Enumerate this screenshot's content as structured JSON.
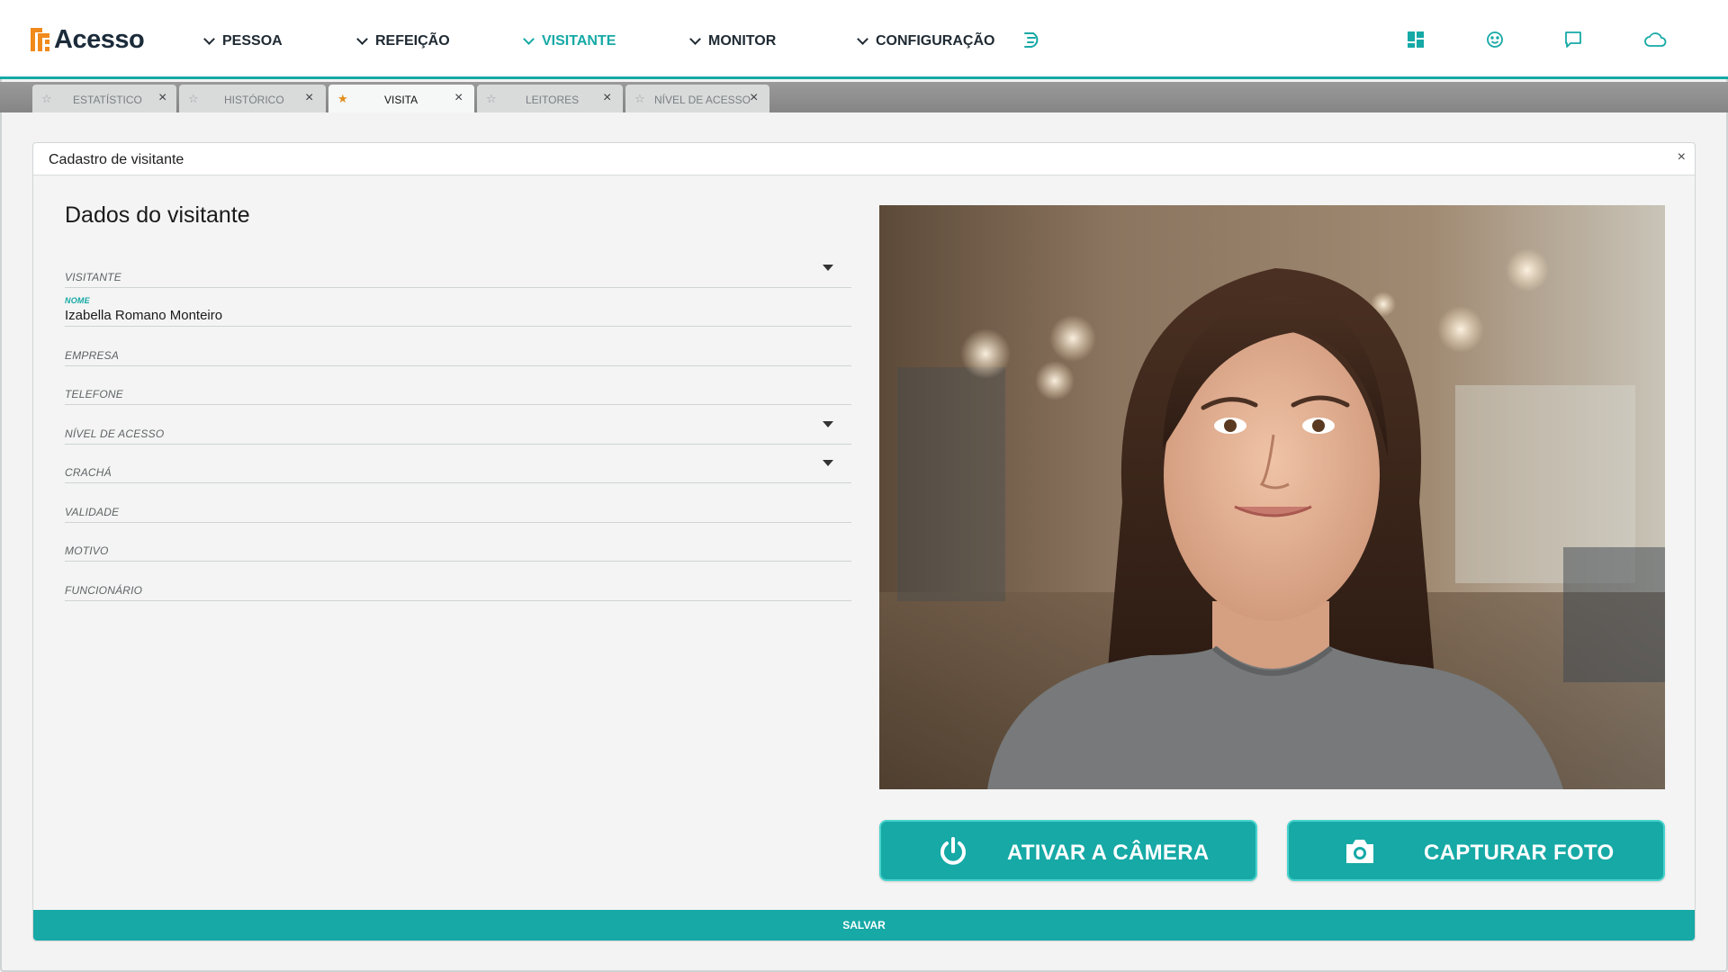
{
  "app": {
    "logo_text": "Acesso",
    "brand_color": "#16a9a6",
    "logo_color": "#f08a1c"
  },
  "nav": {
    "items": [
      {
        "label": "PESSOA",
        "active": false
      },
      {
        "label": "REFEIÇÃO",
        "active": false
      },
      {
        "label": "VISITANTE",
        "active": true
      },
      {
        "label": "MONITOR",
        "active": false
      },
      {
        "label": "CONFIGURAÇÃO",
        "active": false
      }
    ],
    "extra_icon": "menu-history-icon"
  },
  "top_icons": [
    "dashboard-icon",
    "smiley-face-icon",
    "chat-icon",
    "cloud-icon"
  ],
  "tabs": [
    {
      "label": "ESTATÍSTICO",
      "active": false,
      "favorite": false
    },
    {
      "label": "HISTÓRICO",
      "active": false,
      "favorite": false
    },
    {
      "label": "VISITA",
      "active": true,
      "favorite": true
    },
    {
      "label": "LEITORES",
      "active": false,
      "favorite": false
    },
    {
      "label": "NÍVEL DE ACESSO",
      "active": false,
      "favorite": false
    }
  ],
  "panel": {
    "title": "Cadastro de visitante",
    "close": "×",
    "section_title": "Dados do visitante"
  },
  "form": {
    "fields": [
      {
        "label": "VISITANTE",
        "value": "",
        "dropdown": true
      },
      {
        "label": "NOME",
        "value": "Izabella Romano Monteiro",
        "dropdown": false
      },
      {
        "label": "EMPRESA",
        "value": "",
        "dropdown": false
      },
      {
        "label": "TELEFONE",
        "value": "",
        "dropdown": false
      },
      {
        "label": "NÍVEL DE ACESSO",
        "value": "",
        "dropdown": true
      },
      {
        "label": "CRACHÁ",
        "value": "",
        "dropdown": true
      },
      {
        "label": "VALIDADE",
        "value": "",
        "dropdown": false
      },
      {
        "label": "MOTIVO",
        "value": "",
        "dropdown": false
      },
      {
        "label": "FUNCIONÁRIO",
        "value": "",
        "dropdown": false
      }
    ]
  },
  "camera": {
    "activate_label": "ATIVAR A CÂMERA",
    "capture_label": "CAPTURAR FOTO",
    "activate_icon": "power-icon",
    "capture_icon": "camera-icon"
  },
  "footer": {
    "save_label": "SALVAR"
  }
}
